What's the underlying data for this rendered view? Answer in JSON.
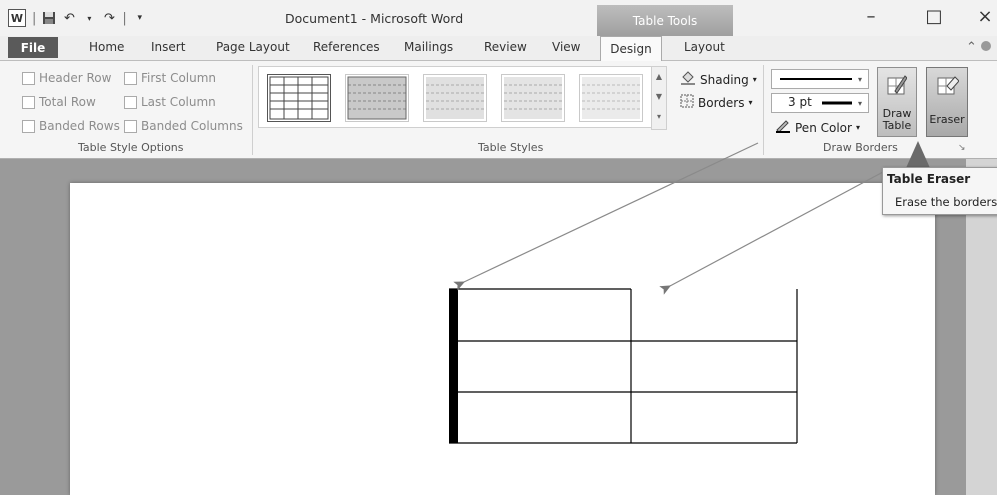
{
  "window": {
    "title": "Document1  -  Microsoft Word",
    "context_tab": "Table Tools",
    "minimize": "–",
    "maximize": "□",
    "close": "×",
    "qat": {
      "logo": "W",
      "undo": "↶",
      "redo": "↷"
    }
  },
  "tabs": [
    "File",
    "Home",
    "Insert",
    "Page Layout",
    "References",
    "Mailings",
    "Review",
    "View",
    "Design",
    "Layout"
  ],
  "active_tab": "Design",
  "ribbon": {
    "table_style_options": {
      "label": "Table Style Options",
      "checkboxes": [
        "Header Row",
        "First Column",
        "Total Row",
        "Last Column",
        "Banded Rows",
        "Banded Columns"
      ]
    },
    "table_styles": {
      "label": "Table Styles",
      "shading": "Shading",
      "borders": "Borders"
    },
    "draw_borders": {
      "label": "Draw Borders",
      "pen_weight": "3 pt",
      "pen_color": "Pen Color",
      "draw_table": "Draw Table",
      "eraser": "Eraser"
    }
  },
  "tooltip": {
    "title": "Table Eraser",
    "body": "Erase the borders"
  },
  "icons": [
    "word-logo-icon",
    "save-icon",
    "undo-icon",
    "redo-icon",
    "shading-bucket-icon",
    "borders-icon",
    "pen-icon",
    "draw-table-icon",
    "eraser-icon",
    "dialog-launcher-icon",
    "help-icon"
  ],
  "colors": {
    "context_tab": "#a8a8a8",
    "file_tab": "#5a5a5a",
    "table_border": "#000000"
  }
}
